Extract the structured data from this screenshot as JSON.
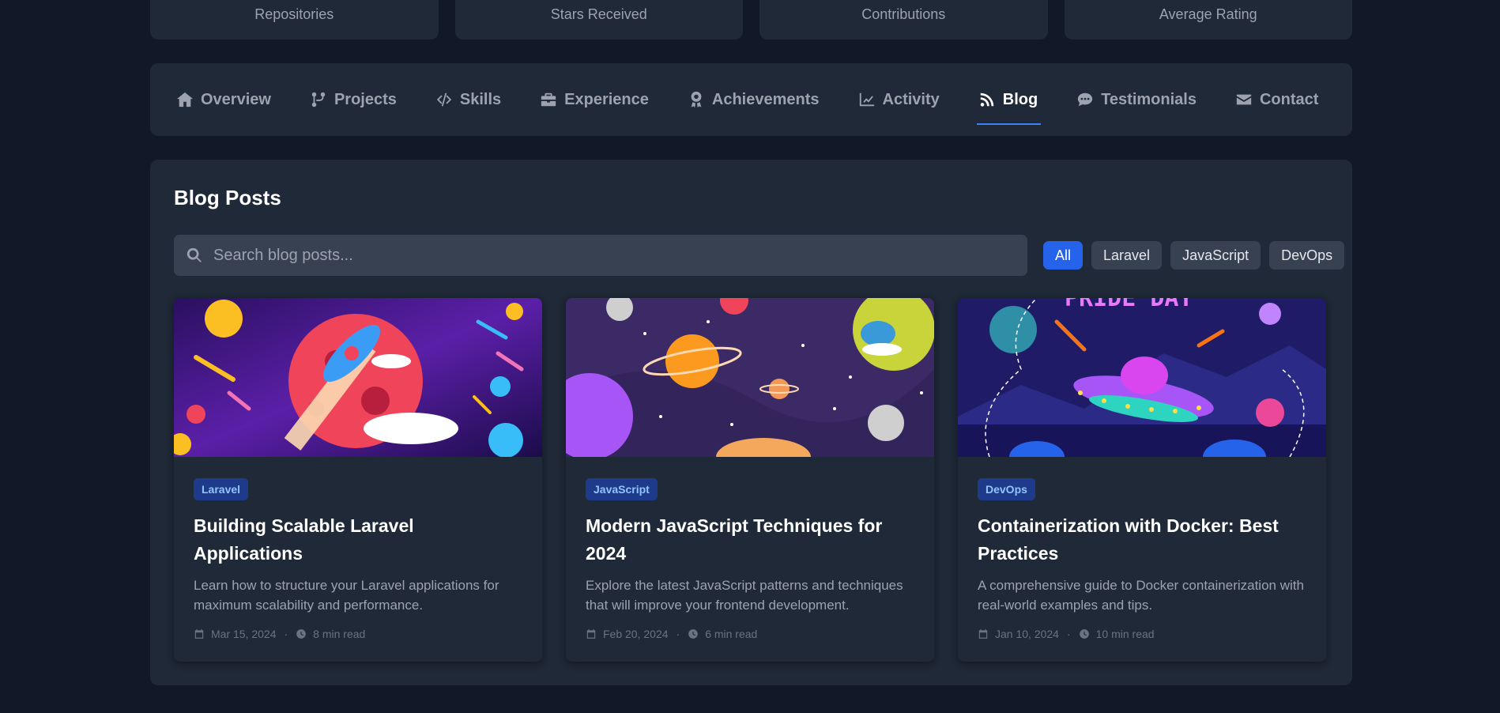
{
  "stats": [
    "Repositories",
    "Stars Received",
    "Contributions",
    "Average Rating"
  ],
  "tabs": [
    {
      "label": "Overview",
      "icon": "home-icon"
    },
    {
      "label": "Projects",
      "icon": "branch-icon"
    },
    {
      "label": "Skills",
      "icon": "code-icon"
    },
    {
      "label": "Experience",
      "icon": "briefcase-icon"
    },
    {
      "label": "Achievements",
      "icon": "award-icon"
    },
    {
      "label": "Activity",
      "icon": "chart-line-icon"
    },
    {
      "label": "Blog",
      "icon": "rss-icon",
      "active": true
    },
    {
      "label": "Testimonials",
      "icon": "comment-icon"
    },
    {
      "label": "Contact",
      "icon": "envelope-icon"
    }
  ],
  "blog": {
    "title": "Blog Posts",
    "search_placeholder": "Search blog posts...",
    "filters": [
      "All",
      "Laravel",
      "JavaScript",
      "DevOps"
    ],
    "active_filter": "All",
    "posts": [
      {
        "tag": "Laravel",
        "title": "Building Scalable Laravel Applications",
        "excerpt": "Learn how to structure your Laravel applications for maximum scalability and performance.",
        "date": "Mar 15, 2024",
        "read_time": "8 min read"
      },
      {
        "tag": "JavaScript",
        "title": "Modern JavaScript Techniques for 2024",
        "excerpt": "Explore the latest JavaScript patterns and techniques that will improve your frontend development.",
        "date": "Feb 20, 2024",
        "read_time": "6 min read"
      },
      {
        "tag": "DevOps",
        "title": "Containerization with Docker: Best Practices",
        "excerpt": "A comprehensive guide to Docker containerization with real-world examples and tips.",
        "date": "Jan 10, 2024",
        "read_time": "10 min read"
      }
    ],
    "image_text": "PRIDE DAY"
  },
  "colors": {
    "background": "#111827",
    "surface": "#1f2937",
    "accent": "#3b82f6",
    "tag_bg": "#1e3a8a",
    "tag_text": "#93c5fd"
  }
}
